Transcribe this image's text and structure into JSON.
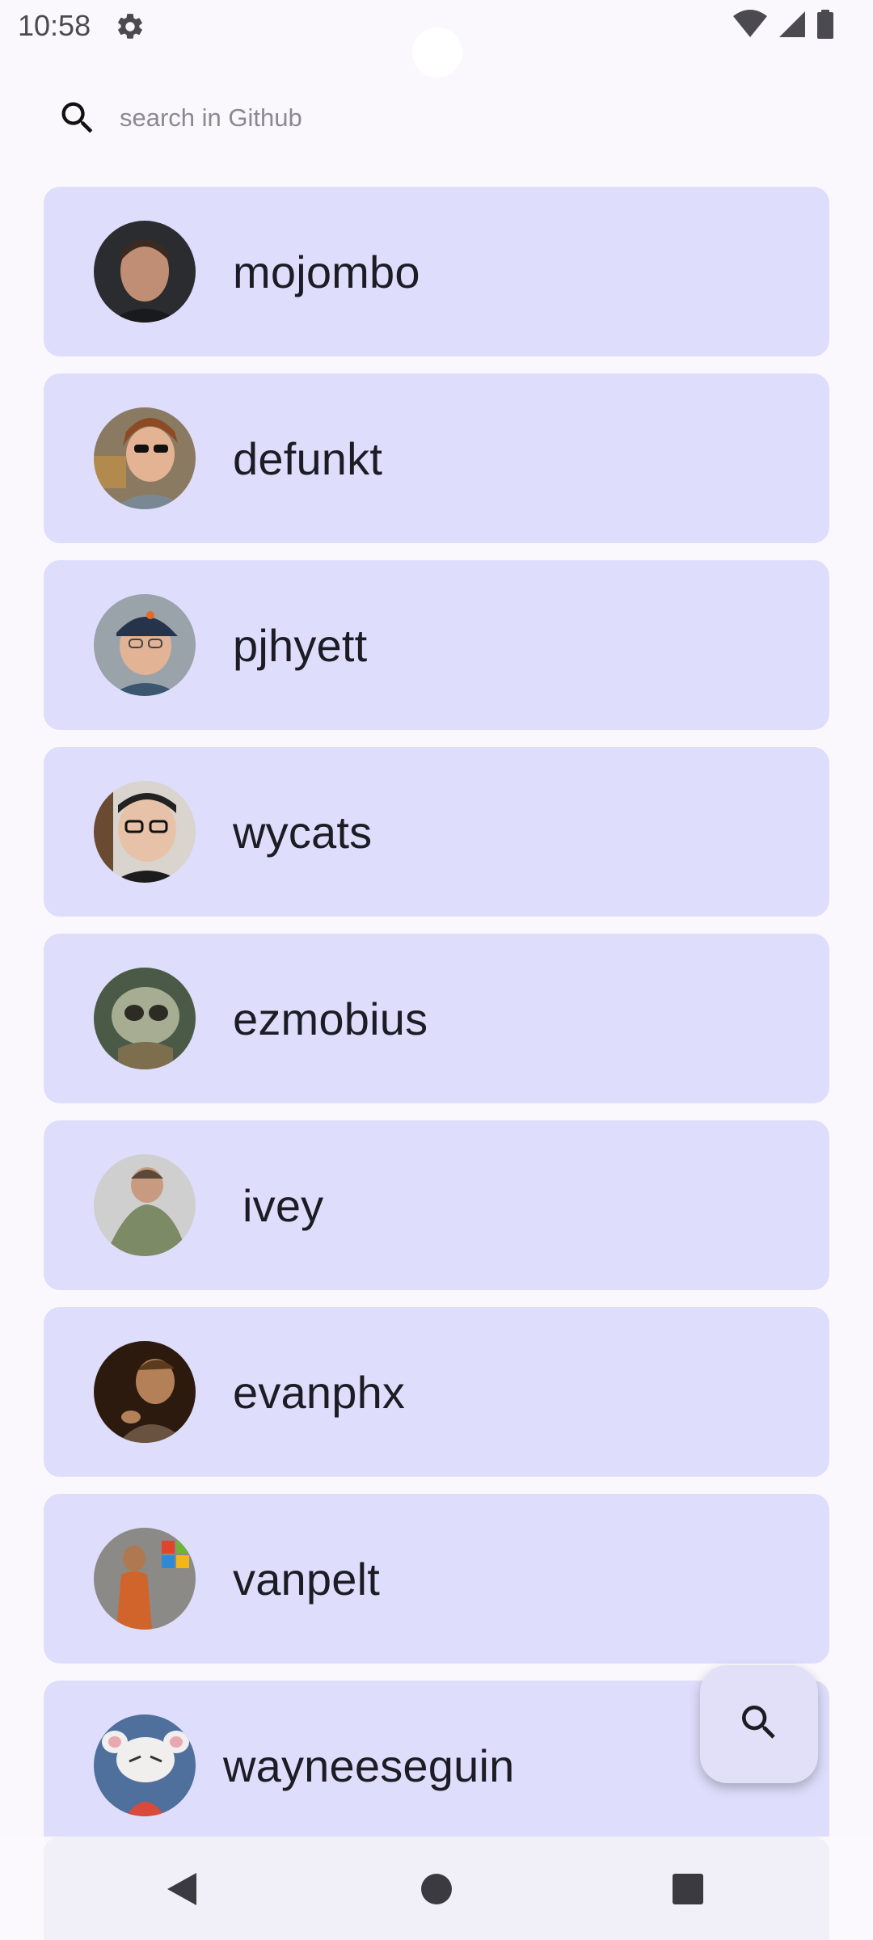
{
  "status_bar": {
    "time": "10:58",
    "icons": [
      "gear-icon",
      "wifi-icon",
      "signal-icon",
      "battery-icon"
    ]
  },
  "search": {
    "placeholder": "search in Github",
    "value": ""
  },
  "users": [
    {
      "login": "mojombo"
    },
    {
      "login": "defunkt"
    },
    {
      "login": "pjhyett"
    },
    {
      "login": "wycats"
    },
    {
      "login": "ezmobius"
    },
    {
      "login": "ivey"
    },
    {
      "login": "evanphx"
    },
    {
      "login": "vanpelt"
    },
    {
      "login": "wayneeseguin"
    }
  ],
  "fab": {
    "icon": "search-icon"
  },
  "navigation": {
    "icons": [
      "back-icon",
      "home-icon",
      "recents-icon"
    ]
  },
  "colors": {
    "background": "#fbf8fd",
    "card": "#dedefc",
    "fab": "#e2e0f8",
    "text": "#1d1c25"
  }
}
